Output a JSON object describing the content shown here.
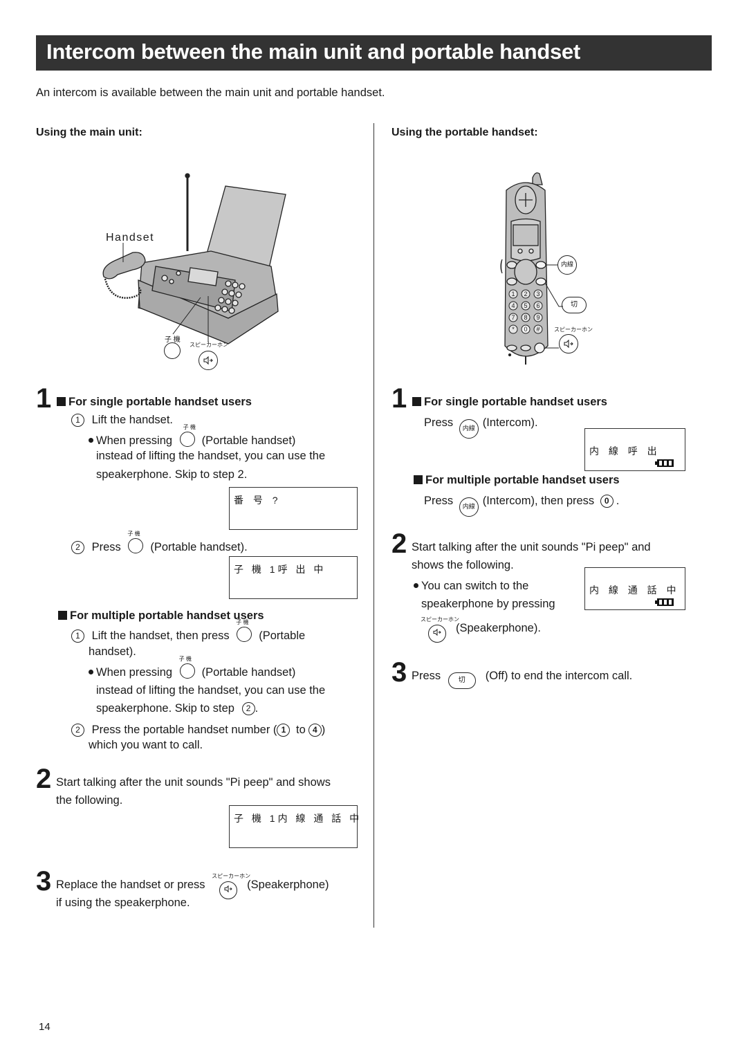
{
  "page": {
    "title": "Intercom between the main unit and portable handset",
    "intro": "An intercom is available between the main unit and portable handset.",
    "page_number": "14"
  },
  "left": {
    "heading": "Using the main unit:",
    "figure": {
      "handset_label": "Handset",
      "btn_portable_caption": "子 機",
      "btn_speaker_caption": "スピーカーホン"
    },
    "step1": {
      "num": "1",
      "single_heading": "For single portable handset users",
      "s1_marker": "1",
      "s1_text": "Lift the handset.",
      "s1_caption": "子 機",
      "s1_bullet_pre": "When pressing",
      "s1_bullet_post": "(Portable handset)",
      "s1_line2": "instead of lifting the handset, you can use the",
      "s1_line3": "speakerphone. Skip to step 2.",
      "lcd1": "番 号 ?",
      "s2_marker": "2",
      "s2_caption": "子 機",
      "s2_pre": "Press",
      "s2_post": "(Portable handset).",
      "lcd2": "子 機 1呼 出 中",
      "multi_heading": "For multiple portable handset users",
      "m1_marker": "1",
      "m1_pre": "Lift the handset, then press",
      "m1_caption": "子 機",
      "m1_post": "(Portable",
      "m1_line2": "handset).",
      "m1_bullet_caption": "子 機",
      "m1_bullet_pre": "When pressing",
      "m1_bullet_post": "(Portable handset)",
      "m1_line3": "instead of lifting the handset, you can use the",
      "m1_line4_pre": "speakerphone. Skip to step",
      "m1_line4_ref": "2",
      "m1_line4_post": ".",
      "m2_marker": "2",
      "m2_pre": "Press the portable handset number (",
      "m2_from": "1",
      "m2_mid": "to",
      "m2_to": "4",
      "m2_post": ")",
      "m2_line2": "which you want to call."
    },
    "step2": {
      "num": "2",
      "line1": "Start talking after the unit sounds \"Pi peep\" and shows",
      "line2": "the following.",
      "lcd": "子 機 1内 線 通 話 中"
    },
    "step3": {
      "num": "3",
      "pre": "Replace the handset or press",
      "caption": "スピーカーホン",
      "post": "(Speakerphone)",
      "line2": "if using the speakerphone."
    }
  },
  "right": {
    "heading": "Using the portable handset:",
    "figure": {
      "btn_intercom": "内線",
      "btn_off": "切",
      "btn_speaker_caption": "スピーカーホン",
      "keypad": [
        "1",
        "2",
        "3",
        "4",
        "5",
        "6",
        "7",
        "8",
        "9",
        "*",
        "0",
        "#"
      ]
    },
    "step1": {
      "num": "1",
      "single_heading": "For single portable handset users",
      "single_pre": "Press",
      "single_btn": "内線",
      "single_post": "(Intercom).",
      "lcd1": "内 線 呼 出",
      "multi_heading": "For multiple portable handset users",
      "multi_pre": "Press",
      "multi_btn": "内線",
      "multi_mid": "(Intercom), then press",
      "multi_key": "0",
      "multi_post": "."
    },
    "step2": {
      "num": "2",
      "line1": "Start talking after the unit sounds \"Pi peep\" and",
      "line2": "shows the following.",
      "bullet1": "You can switch to the",
      "bullet2": "speakerphone by pressing",
      "caption": "スピーカーホン",
      "post": "(Speakerphone).",
      "lcd": "内 線 通 話 中"
    },
    "step3": {
      "num": "3",
      "pre": "Press",
      "btn": "切",
      "post": "(Off) to end the intercom call."
    }
  }
}
